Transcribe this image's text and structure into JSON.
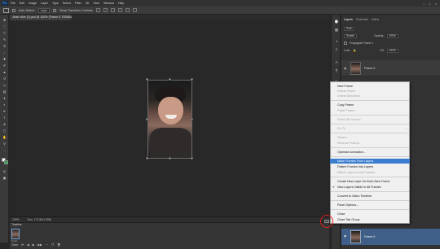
{
  "menubar": {
    "logo": "Ps",
    "items": [
      "File",
      "Edit",
      "Image",
      "Layer",
      "Type",
      "Select",
      "Filter",
      "3D",
      "View",
      "Window",
      "Help"
    ],
    "window_buttons": [
      "–",
      "□",
      "×"
    ]
  },
  "options": {
    "auto_select_label": "Auto-Select:",
    "auto_select_value": "Layer",
    "show_transform_label": "Show Transform Controls"
  },
  "document": {
    "tab_title": "Jimin vlive (2).psd @ 100% (Frame 0, RGB/8)"
  },
  "status": {
    "zoom": "100%",
    "doc_size": "Doc: 171.5K/1.09M"
  },
  "timeline": {
    "title": "Timeline",
    "frame_delay": "0 sec.",
    "loop_value": "Once"
  },
  "layers_panel": {
    "tabs": [
      "Layers",
      "Channels",
      "Paths"
    ],
    "kind_label": "Kind",
    "blend_mode": "Screen",
    "opacity_label": "Opacity:",
    "opacity_value": "100%",
    "lock_label": "Lock:",
    "fill_label": "Fill:",
    "fill_value": "100%",
    "propagate_label": "Propagate Frame 1",
    "layer_name": "Frame 0",
    "layer_name_2": "Frame 0"
  },
  "context_menu": {
    "new_frame": "New Frame",
    "delete_frame": "Delete Frame",
    "delete_animation": "Delete Animation",
    "copy_frame": "Copy Frame",
    "paste_frame": "Paste Frame...",
    "select_all_frames": "Select All Frames",
    "go_to": "Go To",
    "tween": "Tween...",
    "reverse_frames": "Reverse Frames",
    "optimize_animation": "Optimize Animation...",
    "make_frames_from_layers": "Make Frames From Layers",
    "flatten_frames": "Flatten Frames Into Layers",
    "match_layer": "Match Layer Across Frames...",
    "create_new_layer": "Create New Layer for Each New Frame",
    "new_layers_visible": "New Layers Visible in All Frames",
    "convert_timeline": "Convert to Video Timeline",
    "panel_options": "Panel Options...",
    "close": "Close",
    "close_tab_group": "Close Tab Group"
  },
  "colors": {
    "highlight": "#3b7ed0",
    "annotation": "#e01f1f"
  }
}
